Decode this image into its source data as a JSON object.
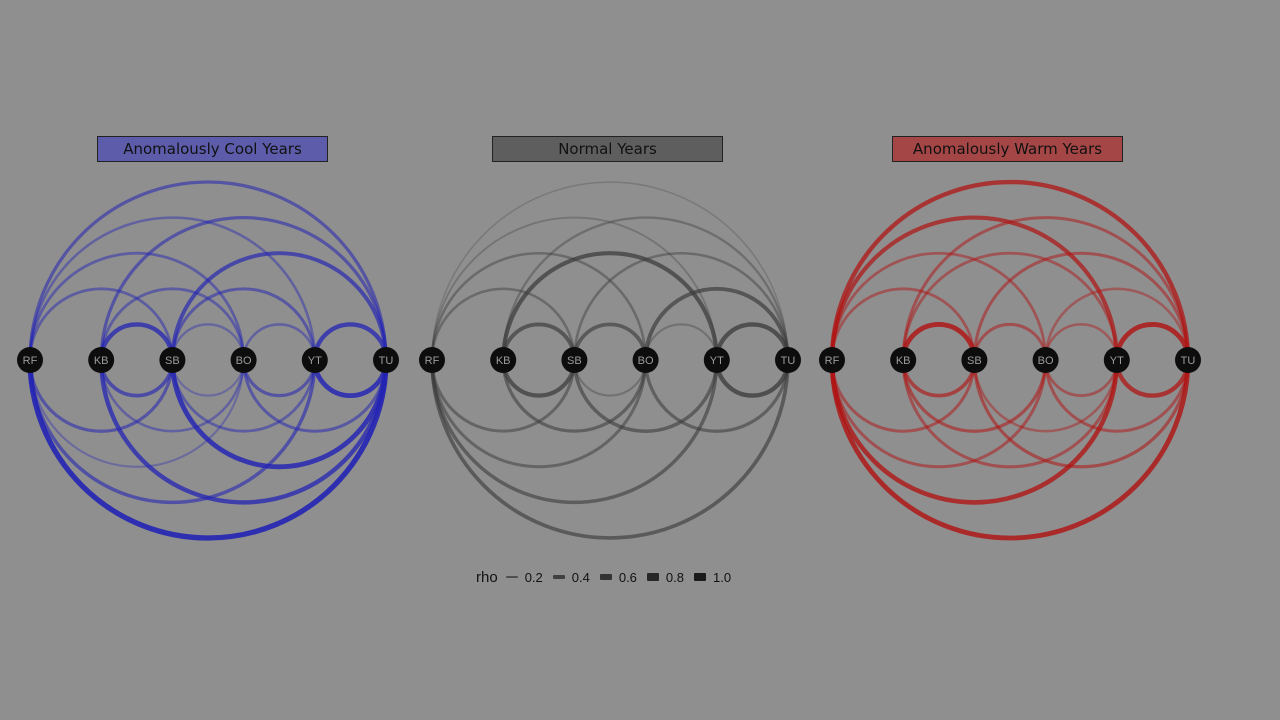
{
  "nodes": [
    "RF",
    "KB",
    "SB",
    "BO",
    "YT",
    "TU"
  ],
  "panels": [
    {
      "title": "Anomalously Cool Years",
      "color": "#2424b4",
      "title_bg": "#5c5cab",
      "edges_above": [
        {
          "from": "RF",
          "to": "TU",
          "rho": 0.5
        },
        {
          "from": "RF",
          "to": "YT",
          "rho": 0.35
        },
        {
          "from": "RF",
          "to": "BO",
          "rho": 0.4
        },
        {
          "from": "RF",
          "to": "SB",
          "rho": 0.4
        },
        {
          "from": "KB",
          "to": "TU",
          "rho": 0.5
        },
        {
          "from": "KB",
          "to": "BO",
          "rho": 0.4
        },
        {
          "from": "KB",
          "to": "SB",
          "rho": 0.75
        },
        {
          "from": "SB",
          "to": "TU",
          "rho": 0.65
        },
        {
          "from": "SB",
          "to": "YT",
          "rho": 0.45
        },
        {
          "from": "SB",
          "to": "BO",
          "rho": 0.3
        },
        {
          "from": "BO",
          "to": "YT",
          "rho": 0.35
        },
        {
          "from": "YT",
          "to": "TU",
          "rho": 0.75
        }
      ],
      "edges_below": [
        {
          "from": "RF",
          "to": "TU",
          "rho": 0.95
        },
        {
          "from": "RF",
          "to": "YT",
          "rho": 0.55
        },
        {
          "from": "RF",
          "to": "BO",
          "rho": 0.25
        },
        {
          "from": "RF",
          "to": "SB",
          "rho": 0.5
        },
        {
          "from": "KB",
          "to": "TU",
          "rho": 0.75
        },
        {
          "from": "KB",
          "to": "BO",
          "rho": 0.35
        },
        {
          "from": "KB",
          "to": "SB",
          "rho": 0.6
        },
        {
          "from": "SB",
          "to": "TU",
          "rho": 0.85
        },
        {
          "from": "SB",
          "to": "YT",
          "rho": 0.4
        },
        {
          "from": "SB",
          "to": "BO",
          "rho": 0.25
        },
        {
          "from": "BO",
          "to": "TU",
          "rho": 0.45
        },
        {
          "from": "BO",
          "to": "YT",
          "rho": 0.5
        },
        {
          "from": "YT",
          "to": "TU",
          "rho": 0.85
        }
      ]
    },
    {
      "title": "Normal Years",
      "color": "#3a3a3a",
      "title_bg": "#5e5e5e",
      "edges_above": [
        {
          "from": "RF",
          "to": "TU",
          "rho": 0.12
        },
        {
          "from": "RF",
          "to": "YT",
          "rho": 0.2
        },
        {
          "from": "RF",
          "to": "BO",
          "rho": 0.35
        },
        {
          "from": "RF",
          "to": "SB",
          "rho": 0.35
        },
        {
          "from": "KB",
          "to": "TU",
          "rho": 0.3
        },
        {
          "from": "KB",
          "to": "YT",
          "rho": 0.7
        },
        {
          "from": "KB",
          "to": "SB",
          "rho": 0.65
        },
        {
          "from": "SB",
          "to": "BO",
          "rho": 0.6
        },
        {
          "from": "SB",
          "to": "TU",
          "rho": 0.35
        },
        {
          "from": "BO",
          "to": "TU",
          "rho": 0.65
        },
        {
          "from": "BO",
          "to": "YT",
          "rho": 0.25
        },
        {
          "from": "YT",
          "to": "TU",
          "rho": 0.75
        }
      ],
      "edges_below": [
        {
          "from": "RF",
          "to": "TU",
          "rho": 0.6
        },
        {
          "from": "RF",
          "to": "YT",
          "rho": 0.55
        },
        {
          "from": "RF",
          "to": "BO",
          "rho": 0.45
        },
        {
          "from": "RF",
          "to": "SB",
          "rho": 0.45
        },
        {
          "from": "KB",
          "to": "BO",
          "rho": 0.5
        },
        {
          "from": "KB",
          "to": "SB",
          "rho": 0.7
        },
        {
          "from": "SB",
          "to": "YT",
          "rho": 0.55
        },
        {
          "from": "SB",
          "to": "BO",
          "rho": 0.25
        },
        {
          "from": "BO",
          "to": "TU",
          "rho": 0.5
        },
        {
          "from": "YT",
          "to": "TU",
          "rho": 0.75
        }
      ]
    },
    {
      "title": "Anomalously Warm Years",
      "color": "#b01414",
      "title_bg": "#a54646",
      "edges_above": [
        {
          "from": "RF",
          "to": "TU",
          "rho": 0.75
        },
        {
          "from": "RF",
          "to": "YT",
          "rho": 0.7
        },
        {
          "from": "RF",
          "to": "BO",
          "rho": 0.4
        },
        {
          "from": "RF",
          "to": "SB",
          "rho": 0.4
        },
        {
          "from": "KB",
          "to": "TU",
          "rho": 0.45
        },
        {
          "from": "KB",
          "to": "YT",
          "rho": 0.4
        },
        {
          "from": "KB",
          "to": "SB",
          "rho": 0.85
        },
        {
          "from": "SB",
          "to": "TU",
          "rho": 0.45
        },
        {
          "from": "SB",
          "to": "BO",
          "rho": 0.45
        },
        {
          "from": "BO",
          "to": "TU",
          "rho": 0.35
        },
        {
          "from": "BO",
          "to": "YT",
          "rho": 0.35
        },
        {
          "from": "YT",
          "to": "TU",
          "rho": 0.85
        }
      ],
      "edges_below": [
        {
          "from": "RF",
          "to": "TU",
          "rho": 0.85
        },
        {
          "from": "RF",
          "to": "YT",
          "rho": 0.8
        },
        {
          "from": "RF",
          "to": "BO",
          "rho": 0.45
        },
        {
          "from": "RF",
          "to": "SB",
          "rho": 0.45
        },
        {
          "from": "KB",
          "to": "YT",
          "rho": 0.45
        },
        {
          "from": "KB",
          "to": "BO",
          "rho": 0.5
        },
        {
          "from": "KB",
          "to": "SB",
          "rho": 0.6
        },
        {
          "from": "SB",
          "to": "TU",
          "rho": 0.5
        },
        {
          "from": "SB",
          "to": "YT",
          "rho": 0.35
        },
        {
          "from": "BO",
          "to": "TU",
          "rho": 0.45
        },
        {
          "from": "BO",
          "to": "YT",
          "rho": 0.4
        },
        {
          "from": "YT",
          "to": "TU",
          "rho": 0.75
        }
      ]
    }
  ],
  "legend": {
    "title": "rho",
    "items": [
      {
        "label": "0.2",
        "value": 0.2
      },
      {
        "label": "0.4",
        "value": 0.4
      },
      {
        "label": "0.6",
        "value": 0.6
      },
      {
        "label": "0.8",
        "value": 0.8
      },
      {
        "label": "1.0",
        "value": 1.0
      }
    ]
  }
}
